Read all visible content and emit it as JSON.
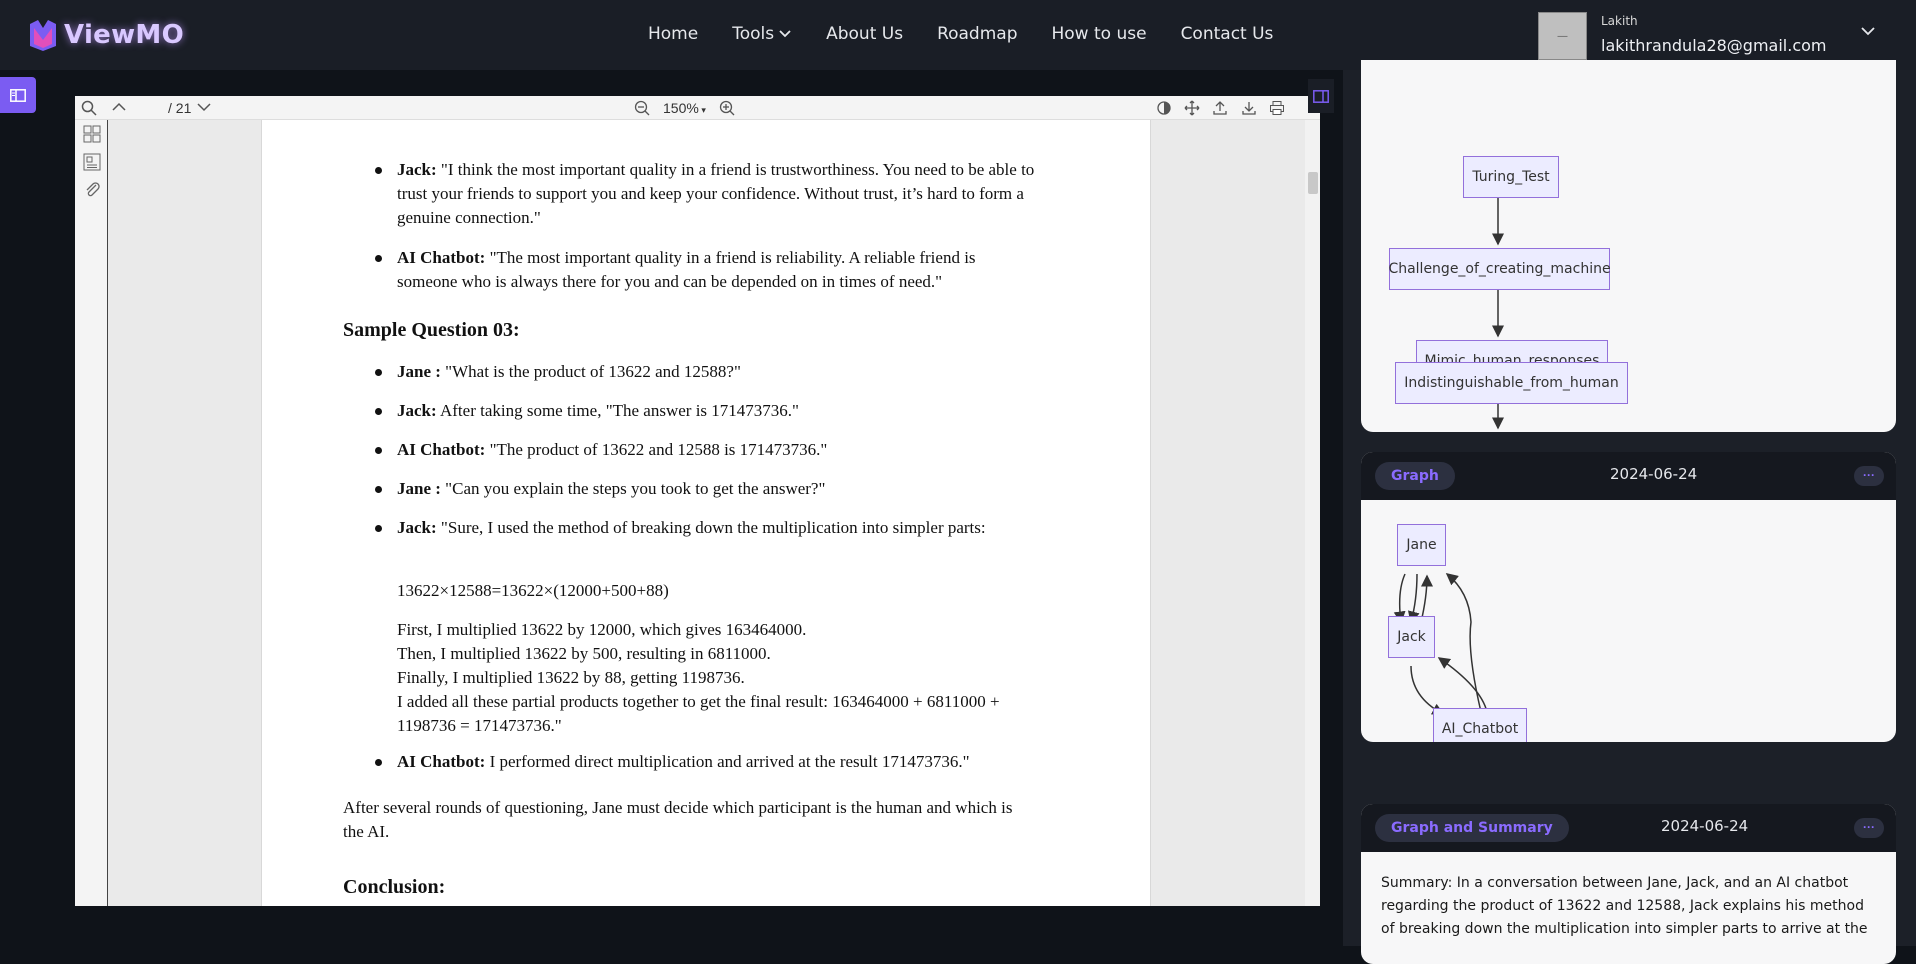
{
  "nav": {
    "brand": "ViewMO",
    "menu": [
      "Home",
      "Tools",
      "About Us",
      "Roadmap",
      "How to use",
      "Contact Us"
    ],
    "user_name": "Lakith",
    "user_email": "lakithrandula28@gmail.com",
    "avatar_text": "—"
  },
  "viewer": {
    "page_count": "/ 21",
    "zoom": "150%"
  },
  "document": {
    "b1_label": "Jack:",
    "b1_text": " \"I think the most important quality in a friend is trustworthiness. You need to be able to trust your friends to support you and keep your confidence. Without trust, it’s hard to form a genuine connection.\"",
    "b2_label": "AI Chatbot:",
    "b2_text": " \"The most important quality in a friend is reliability. A reliable friend is someone who is always there for you and can be depended on in times of need.\"",
    "heading_q3": "Sample Question 03:",
    "q1_label": "Jane :",
    "q1_text": " \"What is the product of 13622 and 12588?\"",
    "q2_label": "Jack:",
    "q2_text": " After taking some time, \"The answer is 171473736.\"",
    "q3_label": "AI Chatbot:",
    "q3_text": " \"The product of 13622 and 12588 is 171473736.\"",
    "q4_label": "Jane :",
    "q4_text": " \"Can you explain the steps you took to get the answer?\"",
    "q5_label": "Jack:",
    "q5_text": " \"Sure, I used the method of breaking down the multiplication into simpler parts:",
    "eq": "13622×12588=13622×(12000+500+88)",
    "step1": "First, I multiplied 13622 by 12000, which gives 163464000.",
    "step2": "Then, I multiplied 13622 by 500, resulting in 6811000.",
    "step3": "Finally, I multiplied 13622 by 88, getting 1198736.",
    "step4": "I added all these partial products together to get the final result: 163464000 + 6811000 + 1198736 = 171473736.\"",
    "q6_label": "AI Chatbot:",
    "q6_text": " I performed direct multiplication and arrived at the result 171473736.\"",
    "closing": "After several rounds of questioning, Jane must decide which participant is the human and which is the AI.",
    "heading_conclusion": "Conclusion:"
  },
  "panel": {
    "flow_nodes": [
      "Turing_Test",
      "Challenge_of_creating_machine",
      "Mimic_human_responses",
      "Indistinguishable_from_human"
    ],
    "card2_tag": "Graph",
    "card2_date": "2024-06-24",
    "card2_more": "···",
    "graph_nodes": [
      "Jane",
      "Jack",
      "AI_Chatbot"
    ],
    "card3_tag": "Graph and Summary",
    "card3_date": "2024-06-24",
    "card3_more": "···",
    "summary": "Summary: In a conversation between Jane, Jack, and an AI chatbot regarding the product of 13622 and 12588, Jack explains his method of breaking down the multiplication into simpler parts to arrive at the"
  },
  "colors": {
    "accent": "#7b5cf2",
    "nav_bg": "#1a1e26",
    "node_fill": "#ececff",
    "node_border": "#9370db"
  }
}
